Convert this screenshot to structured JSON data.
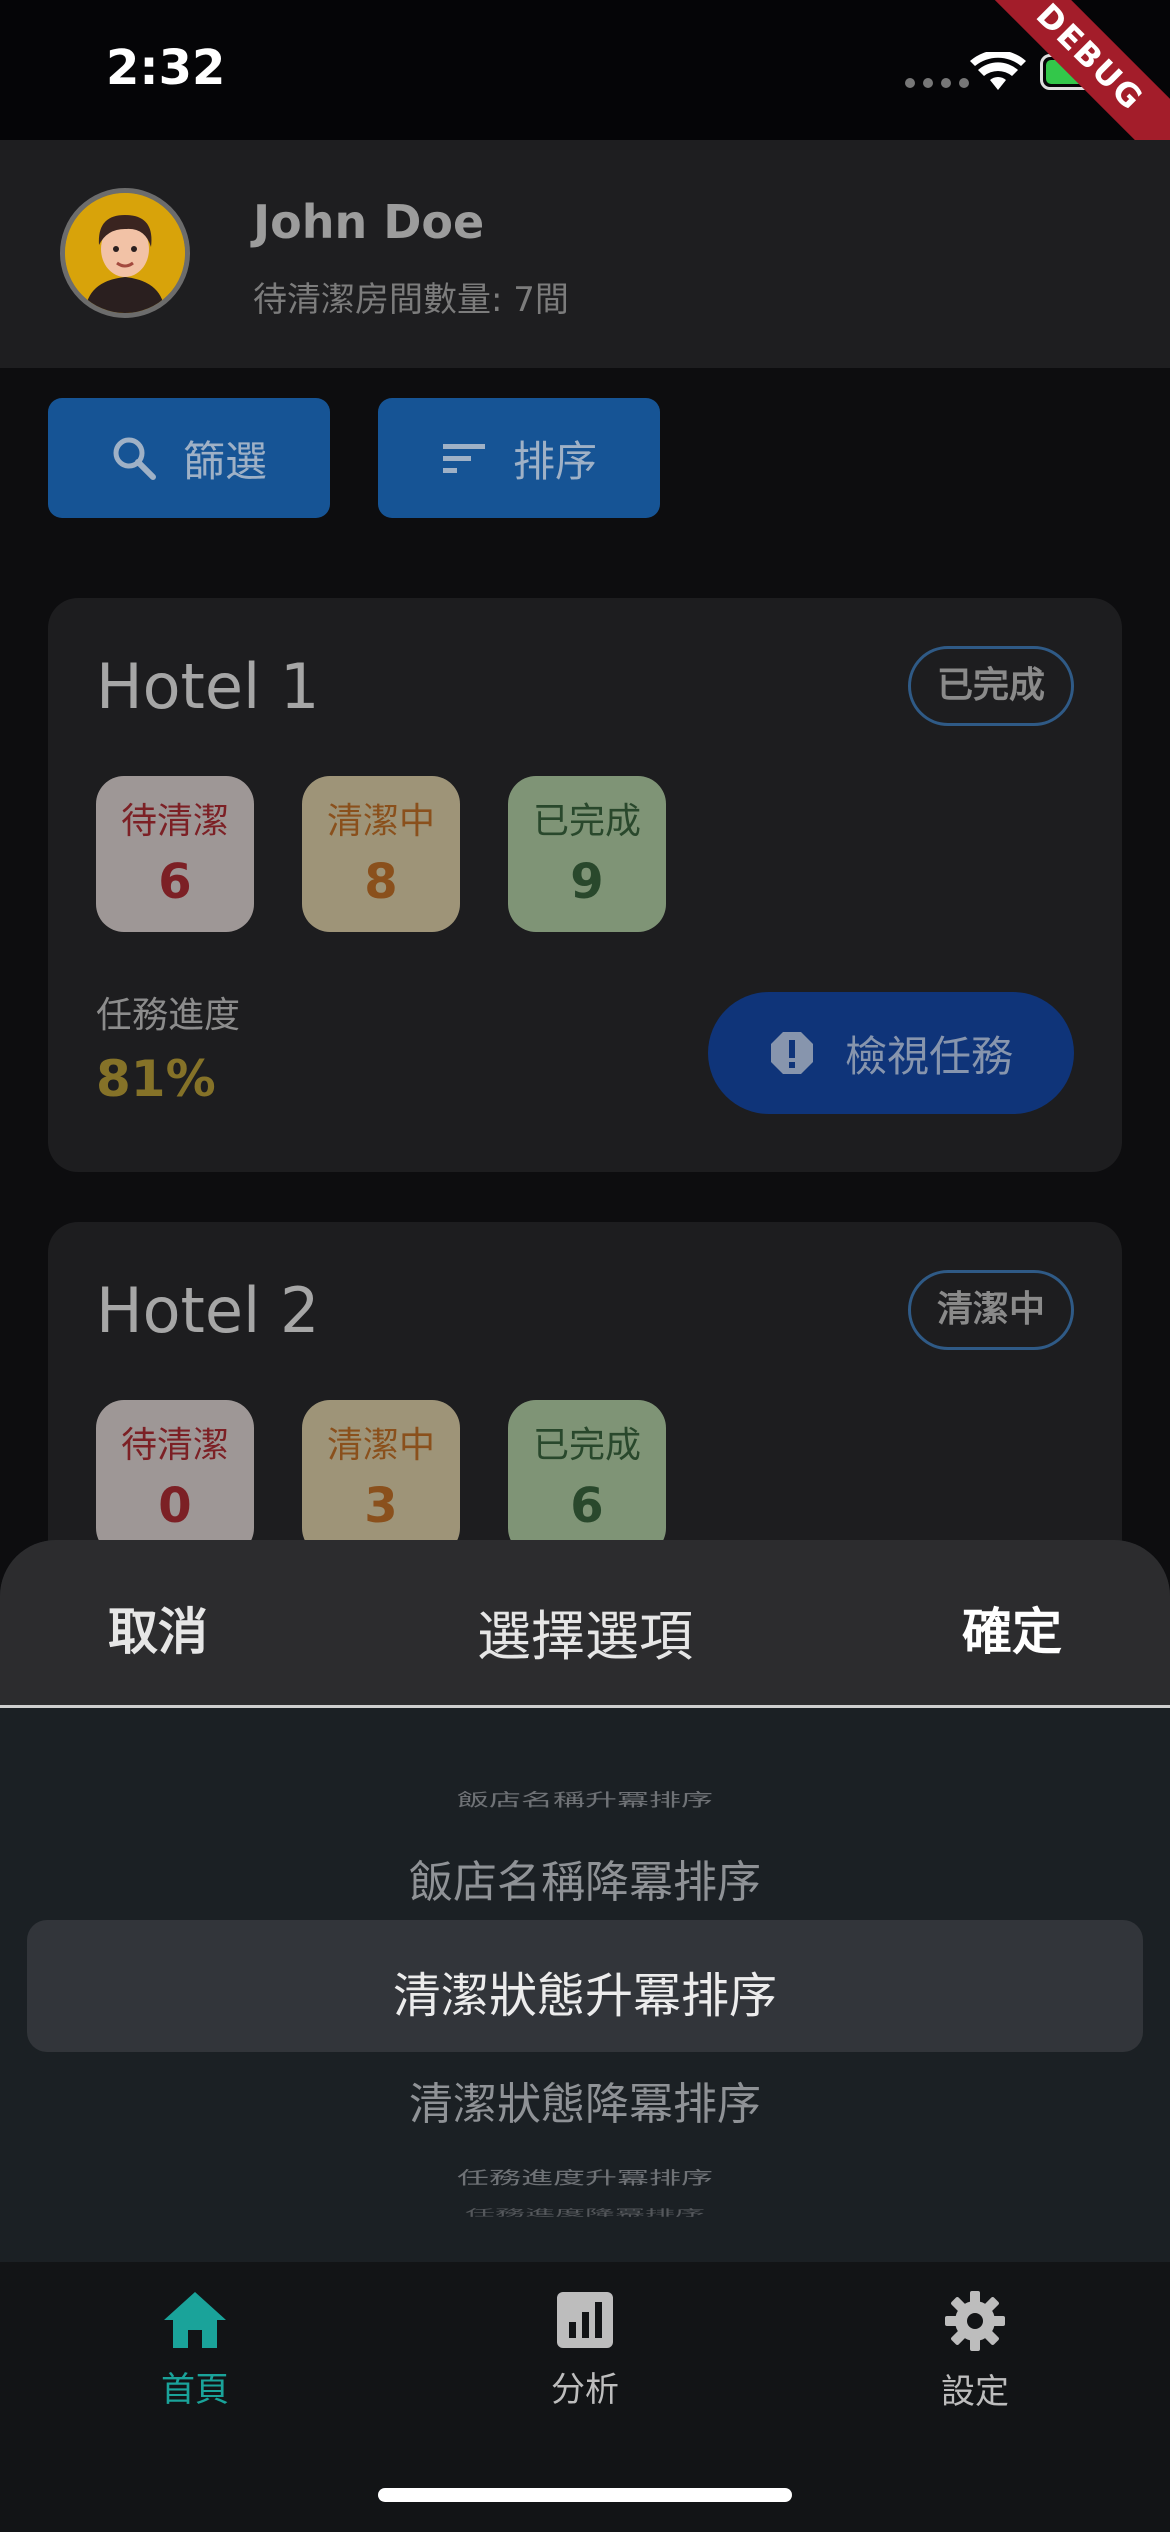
{
  "status_bar": {
    "time": "2:32",
    "debug_label": "DEBUG"
  },
  "header": {
    "user_name": "John Doe",
    "pending_rooms": "待清潔房間數量: 7間"
  },
  "toolbar": {
    "filter_label": "篩選",
    "sort_label": "排序"
  },
  "hotels": [
    {
      "name": "Hotel 1",
      "status": "已完成",
      "stats": [
        {
          "label": "待清潔",
          "value": "6"
        },
        {
          "label": "清潔中",
          "value": "8"
        },
        {
          "label": "已完成",
          "value": "9"
        }
      ],
      "progress_label": "任務進度",
      "progress_value": "81%",
      "action_label": "檢視任務"
    },
    {
      "name": "Hotel 2",
      "status": "清潔中",
      "stats": [
        {
          "label": "待清潔",
          "value": "0"
        },
        {
          "label": "清潔中",
          "value": "3"
        },
        {
          "label": "已完成",
          "value": "6"
        }
      ]
    }
  ],
  "sheet": {
    "cancel": "取消",
    "title": "選擇選項",
    "confirm": "確定",
    "options": [
      "飯店名稱升冪排序",
      "飯店名稱降冪排序",
      "清潔狀態升冪排序",
      "清潔狀態降冪排序",
      "任務進度升冪排序",
      "任務進度降冪排序"
    ],
    "selected_index": 2
  },
  "nav": {
    "home": "首頁",
    "analytics": "分析",
    "settings": "設定"
  },
  "colors": {
    "accent": "#1aa39a",
    "primary_button": "#165495",
    "dialog_bg": "#2c2c2e"
  }
}
